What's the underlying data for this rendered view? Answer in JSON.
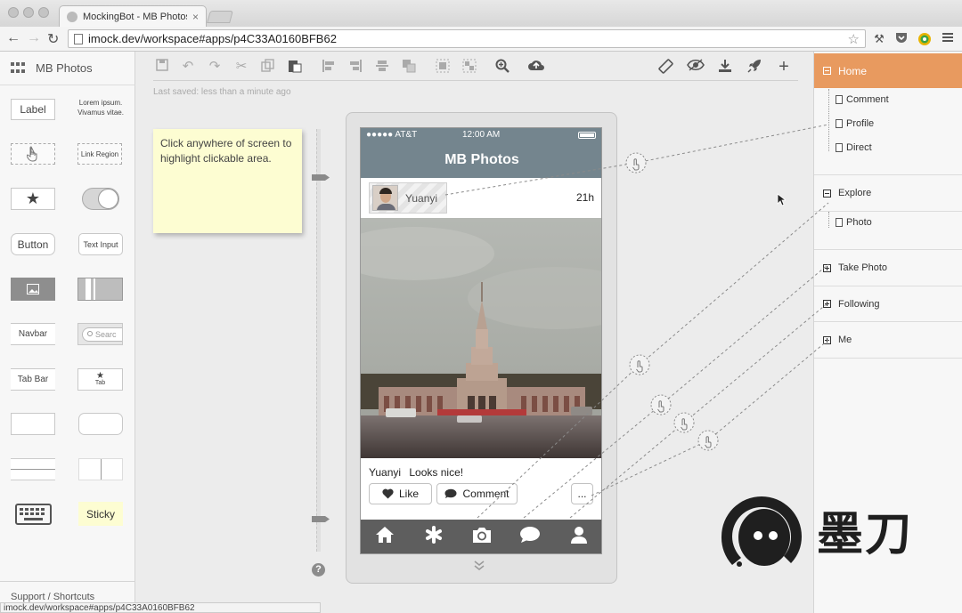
{
  "browser": {
    "tab_title": "MockingBot - MB Photos",
    "tab_close": "×",
    "url": "imock.dev/workspace#apps/p4C33A0160BFB62",
    "status_url": "imock.dev/workspace#apps/p4C33A0160BFB62"
  },
  "sidebar": {
    "project_name": "MB Photos",
    "items": {
      "label": "Label",
      "lorem": "Lorem ipsum. Vivamus vitae.",
      "link_region": "Link Region",
      "button": "Button",
      "text_input": "Text Input",
      "navbar": "Navbar",
      "search": "Searc",
      "tab_bar": "Tab Bar",
      "tab": "Tab",
      "sticky": "Sticky"
    },
    "support": "Support / Shortcuts"
  },
  "editor": {
    "last_saved": "Last saved: less than a minute ago",
    "sticky_note": "Click anywhere of screen to highlight clickable area.",
    "help": "?"
  },
  "phone": {
    "carrier": "●●●●● AT&T",
    "time": "12:00 AM",
    "title": "MB Photos",
    "username": "Yuanyi",
    "post_age": "21h",
    "caption_user": "Yuanyi",
    "caption_text": "Looks nice!",
    "like_label": "Like",
    "comment_label": "Comment",
    "more_label": "...",
    "tabs": [
      "home-icon",
      "asterisk-icon",
      "camera-icon",
      "chat-icon",
      "person-icon"
    ]
  },
  "outline": {
    "home": "Home",
    "home_children": [
      "Comment",
      "Profile",
      "Direct"
    ],
    "explore": "Explore",
    "explore_children": [
      "Photo"
    ],
    "take_photo": "Take Photo",
    "following": "Following",
    "me": "Me"
  },
  "watermark": {
    "text": "墨刀"
  },
  "colors": {
    "accent": "#e89a5f",
    "phone_bar": "#74858e",
    "tab_bar": "#5e5e5e",
    "sticky": "#fdfdd2"
  }
}
